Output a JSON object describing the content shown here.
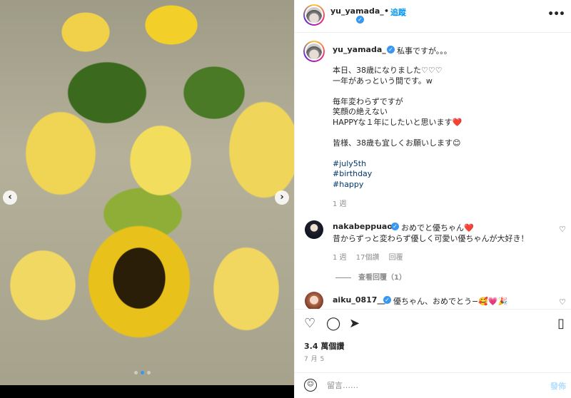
{
  "header": {
    "username": "yu_yamada_",
    "separator": "•",
    "follow_label": "追蹤",
    "verified_mark": "✓",
    "more_icon": "more-horizontal-icon"
  },
  "caption": {
    "username": "yu_yamada_",
    "first_line": "私事ですが。。。",
    "lines": [
      "本日、38歳になりました♡♡♡",
      "一年があっという間です。w",
      "",
      "毎年変わらずですが",
      "笑顔の絶えない",
      "HAPPYな１年にしたいと思います❤️",
      "",
      "皆様、38歳も宜しくお願いします😊",
      "",
      "#july5th",
      "#birthday",
      "#happy"
    ],
    "time": "1 週"
  },
  "comments": [
    {
      "username": "nakabeppuaoi",
      "text_line1": "おめでと優ちゃん❤️",
      "text_line2": "昔からずっと変わらず優しく可愛い優ちゃんが大好き！",
      "time": "1 週",
      "likes": "17個讚",
      "reply": "回覆",
      "view_replies": "查看回覆（1）"
    },
    {
      "username": "aiku_0817__",
      "text": "優ちゃん、おめでとう−🥰💗🎉"
    }
  ],
  "actions": {
    "likes": "3.4 萬個讚",
    "date": "7 月 5"
  },
  "comment_box": {
    "placeholder": "留言……",
    "post_label": "發佈"
  },
  "carousel": {
    "prev": "‹",
    "next": "›",
    "dots": 3,
    "active_index": 1
  },
  "icons": {
    "heart": "♡",
    "like_small": "♡",
    "comment": "◯",
    "share": "➤",
    "save": "▯",
    "emoji": "☺"
  }
}
